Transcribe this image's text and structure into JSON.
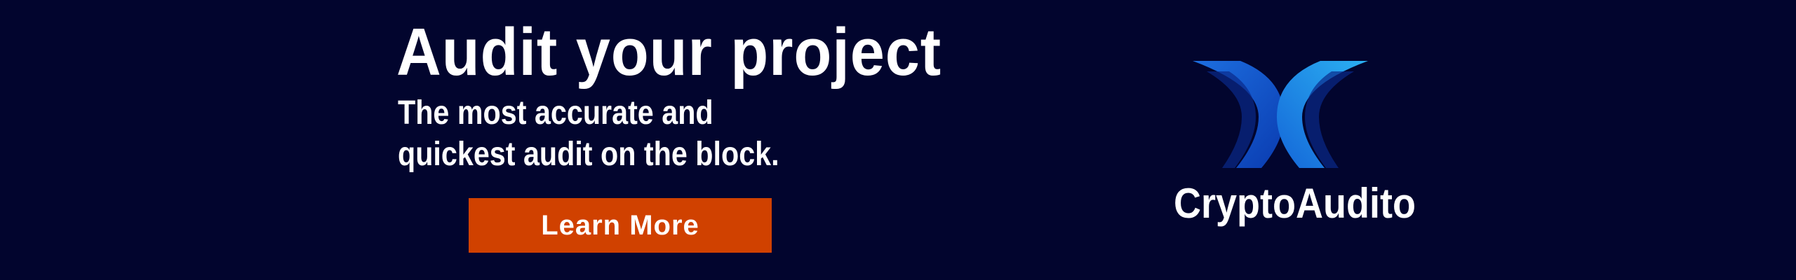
{
  "banner": {
    "headline": "Audit your project",
    "subline_1": "The most accurate and",
    "subline_2": "quickest audit on the block.",
    "cta_label": "Learn More",
    "brand_name": "CryptoAudito"
  },
  "colors": {
    "background": "#02052e",
    "cta": "#d04100",
    "logo_dark": "#0a3bb0",
    "logo_mid": "#1466d8",
    "logo_light": "#22a4ee",
    "text": "#ffffff"
  },
  "icons": {
    "logo": "cryptoaudito-logo-icon"
  }
}
